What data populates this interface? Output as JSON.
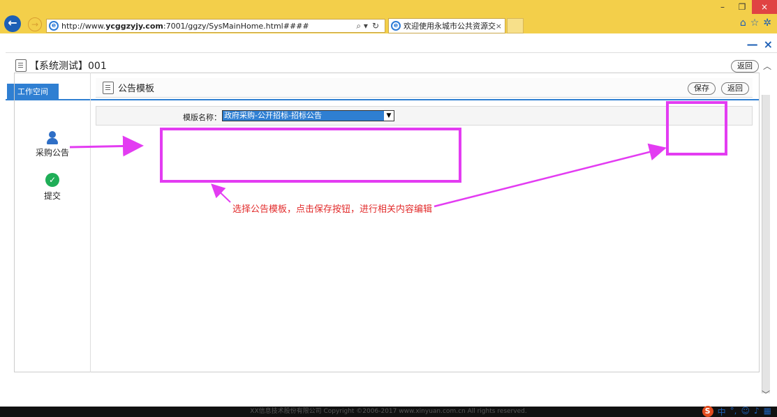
{
  "browser": {
    "url_prefix": "http://www.",
    "url_domain": "ycggzyjy.com",
    "url_rest": ":7001/ggzy/SysMainHome.html####",
    "tab_title": "欢迎使用永城市公共资源交...",
    "tab_close": "×",
    "search_icon": "⌕ ▾",
    "refresh_icon": "↻",
    "home_icon": "⌂",
    "fav_icon": "☆",
    "settings_icon": "✲",
    "minimize": "–",
    "restore": "❐",
    "close": "×"
  },
  "page": {
    "window_minimize": "—",
    "window_close": "×",
    "breadcrumb": "【系统测试】001",
    "back_button": "返回",
    "workspace_tab": "工作空间"
  },
  "sidebar": {
    "items": [
      {
        "label": "采购公告",
        "icon": "person-icon"
      },
      {
        "label": "提交",
        "icon": "check-icon"
      }
    ]
  },
  "panel": {
    "title": "公告模板",
    "save_button": "保存",
    "return_button": "返回",
    "template_label": "模版名称：",
    "template_value": "政府采购-公开招标-招标公告",
    "select_arrow": "▼"
  },
  "annotation": {
    "text": "选择公告模板，点击保存按钮，进行相关内容编辑",
    "color": "#e33cf2"
  },
  "footer": {
    "text": "XX信息技术股份有限公司 Copyright ©2006-2017 www.xinyuan.com.cn All rights reserved."
  }
}
